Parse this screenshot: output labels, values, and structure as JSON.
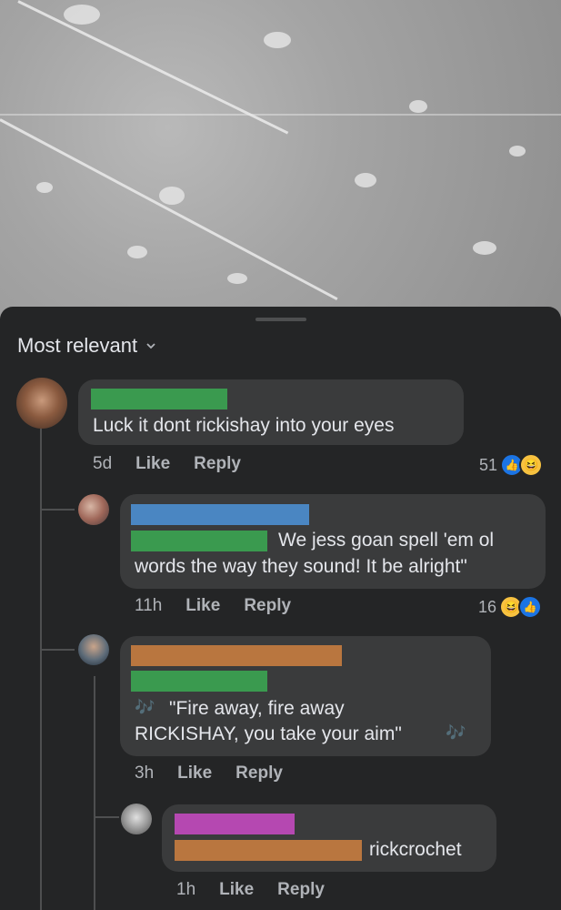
{
  "sort": {
    "label": "Most relevant"
  },
  "comments": [
    {
      "text": "Luck it dont rickishay into your eyes",
      "time": "5d",
      "like_label": "Like",
      "reply_label": "Reply",
      "reaction_count": "51",
      "reactions": [
        "like-icon",
        "haha-icon"
      ]
    },
    {
      "text_line1": "We jess goan spell 'em ol",
      "text_line2": "words the way they sound! It be alright\"",
      "time": "11h",
      "like_label": "Like",
      "reply_label": "Reply",
      "reaction_count": "16",
      "reactions": [
        "haha-icon",
        "like-icon"
      ]
    },
    {
      "text_line1": "\"Fire away, fire away",
      "text_line2": "RICKISHAY, you take your aim\"",
      "time": "3h",
      "like_label": "Like",
      "reply_label": "Reply"
    },
    {
      "text": "rickcrochet",
      "time": "1h",
      "like_label": "Like",
      "reply_label": "Reply"
    }
  ],
  "colors": {
    "redact_green": "#3a9a4f",
    "redact_blue": "#4a86c2",
    "redact_orange": "#b9763f",
    "redact_pink": "#b548b1",
    "like_blue": "#1b74e4",
    "haha_yellow": "#f7c240"
  }
}
